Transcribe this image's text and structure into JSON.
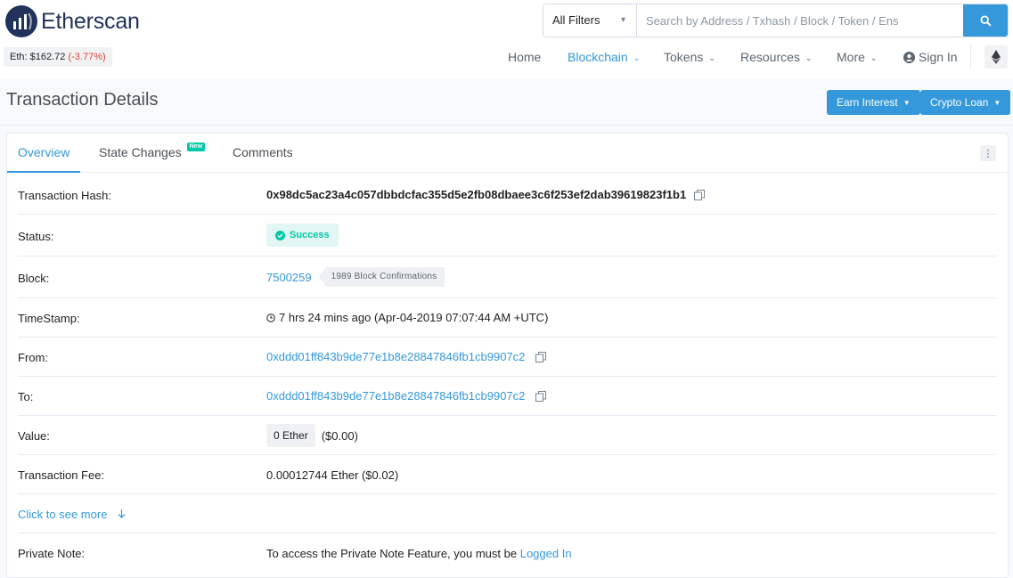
{
  "brand": {
    "name": "Etherscan"
  },
  "price": {
    "label": "Eth:",
    "value": "$162.72",
    "change": "(-3.77%)"
  },
  "search": {
    "filter": "All Filters",
    "placeholder": "Search by Address / Txhash / Block / Token / Ens"
  },
  "nav": {
    "home": "Home",
    "blockchain": "Blockchain",
    "tokens": "Tokens",
    "resources": "Resources",
    "more": "More",
    "signin": "Sign In"
  },
  "page": {
    "title": "Transaction Details",
    "earn_btn": "Earn Interest",
    "loan_btn": "Crypto Loan"
  },
  "tabs": {
    "overview": "Overview",
    "state_changes": "State Changes",
    "new_badge": "New",
    "comments": "Comments"
  },
  "details": {
    "hash_label": "Transaction Hash:",
    "hash": "0x98dc5ac23a4c057dbbdcfac355d5e2fb08dbaee3c6f253ef2dab39619823f1b1",
    "status_label": "Status:",
    "status": "Success",
    "block_label": "Block:",
    "block": "7500259",
    "confirmations": "1989 Block Confirmations",
    "timestamp_label": "TimeStamp:",
    "timestamp": "7 hrs 24 mins ago (Apr-04-2019 07:07:44 AM +UTC)",
    "from_label": "From:",
    "from": "0xddd01ff843b9de77e1b8e28847846fb1cb9907c2",
    "to_label": "To:",
    "to": "0xddd01ff843b9de77e1b8e28847846fb1cb9907c2",
    "value_label": "Value:",
    "value_ether": "0 Ether",
    "value_usd": "($0.00)",
    "fee_label": "Transaction Fee:",
    "fee": "0.00012744 Ether ($0.02)",
    "see_more": "Click to see more",
    "note_label": "Private Note:",
    "note_text": "To access the Private Note Feature, you must be",
    "note_link": "Logged In"
  },
  "colors": {
    "accent": "#3498db",
    "brand": "#21325b",
    "success": "#00c9a7",
    "negative": "#de4437"
  }
}
